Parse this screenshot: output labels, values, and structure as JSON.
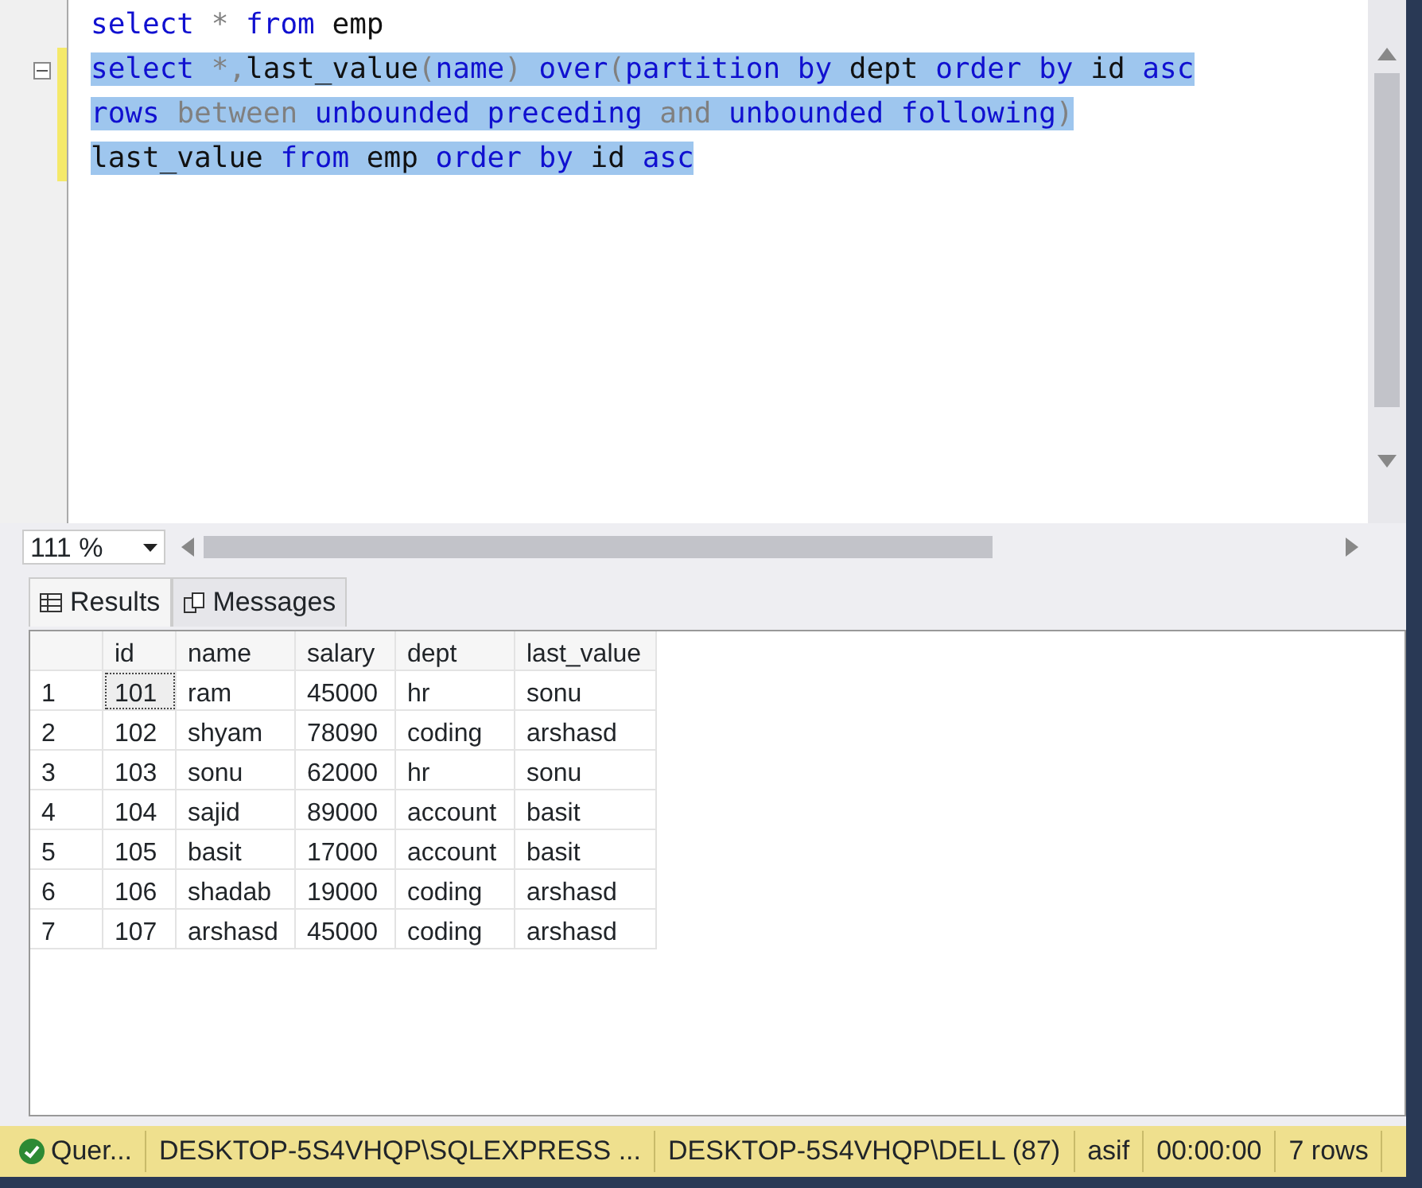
{
  "editor": {
    "lines": [
      {
        "selected": false,
        "collapsible": false,
        "tokens": [
          {
            "kind": "keyword",
            "text": "select"
          },
          {
            "kind": "operator",
            "text": " * "
          },
          {
            "kind": "keyword",
            "text": "from"
          },
          {
            "kind": "plain",
            "text": " emp"
          }
        ]
      },
      {
        "selected": true,
        "collapsible": true,
        "tokens": [
          {
            "kind": "keyword",
            "text": "select"
          },
          {
            "kind": "operator",
            "text": " *,"
          },
          {
            "kind": "plain",
            "text": "last_value"
          },
          {
            "kind": "operator",
            "text": "("
          },
          {
            "kind": "keyword",
            "text": "name"
          },
          {
            "kind": "operator",
            "text": ")"
          },
          {
            "kind": "keyword",
            "text": " over"
          },
          {
            "kind": "operator",
            "text": "("
          },
          {
            "kind": "keyword",
            "text": "partition by"
          },
          {
            "kind": "plain",
            "text": " dept "
          },
          {
            "kind": "keyword",
            "text": "order by"
          },
          {
            "kind": "plain",
            "text": " id "
          },
          {
            "kind": "keyword",
            "text": "asc"
          }
        ]
      },
      {
        "selected": true,
        "collapsible": false,
        "tokens": [
          {
            "kind": "keyword",
            "text": "rows"
          },
          {
            "kind": "operator",
            "text": " between "
          },
          {
            "kind": "keyword",
            "text": "unbounded preceding"
          },
          {
            "kind": "operator",
            "text": " and "
          },
          {
            "kind": "keyword",
            "text": "unbounded following"
          },
          {
            "kind": "operator",
            "text": ")"
          }
        ]
      },
      {
        "selected": true,
        "collapsible": false,
        "tokens": [
          {
            "kind": "plain",
            "text": "last_value "
          },
          {
            "kind": "keyword",
            "text": "from"
          },
          {
            "kind": "plain",
            "text": " emp "
          },
          {
            "kind": "keyword",
            "text": "order by"
          },
          {
            "kind": "plain",
            "text": " id "
          },
          {
            "kind": "keyword",
            "text": "asc"
          }
        ]
      }
    ]
  },
  "zoom": {
    "value": "111 %"
  },
  "tabs": [
    {
      "label": "Results",
      "selected": true
    },
    {
      "label": "Messages",
      "selected": false
    }
  ],
  "table": {
    "columns": [
      "id",
      "name",
      "salary",
      "dept",
      "last_value"
    ],
    "rows": [
      {
        "number": "1",
        "cells": [
          "101",
          "ram",
          "45000",
          "hr",
          "sonu"
        ]
      },
      {
        "number": "2",
        "cells": [
          "102",
          "shyam",
          "78090",
          "coding",
          "arshasd"
        ]
      },
      {
        "number": "3",
        "cells": [
          "103",
          "sonu",
          "62000",
          "hr",
          "sonu"
        ]
      },
      {
        "number": "4",
        "cells": [
          "104",
          "sajid",
          "89000",
          "account",
          "basit"
        ]
      },
      {
        "number": "5",
        "cells": [
          "105",
          "basit",
          "17000",
          "account",
          "basit"
        ]
      },
      {
        "number": "6",
        "cells": [
          "106",
          "shadab",
          "19000",
          "coding",
          "arshasd"
        ]
      },
      {
        "number": "7",
        "cells": [
          "107",
          "arshasd",
          "45000",
          "coding",
          "arshasd"
        ]
      }
    ]
  },
  "status_bar": {
    "query_status": "Quer...",
    "server": "DESKTOP-5S4VHQP\\SQLEXPRESS ...",
    "login": "DESKTOP-5S4VHQP\\DELL (87)",
    "database": "asif",
    "elapsed": "00:00:00",
    "row_count": "7 rows"
  }
}
